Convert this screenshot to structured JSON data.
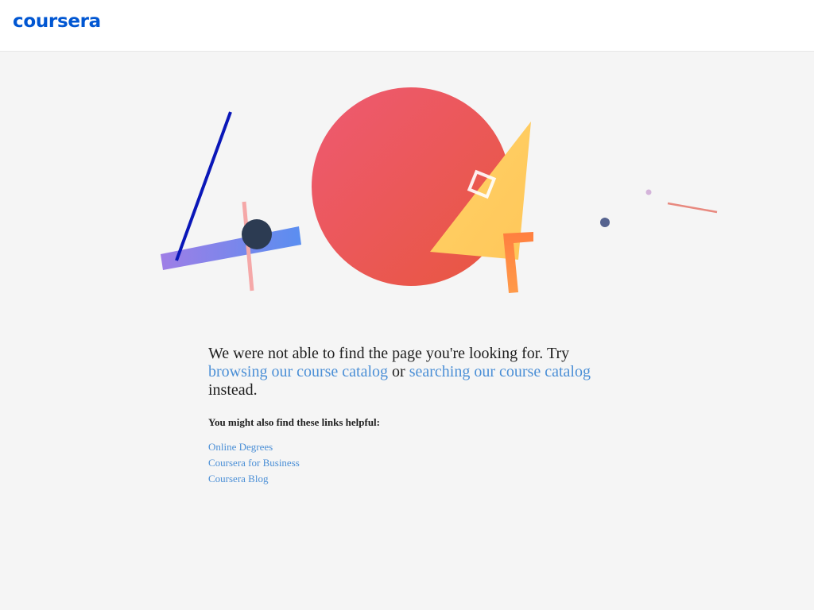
{
  "header": {
    "logo_text": "coursera"
  },
  "illustration": {
    "icon": "404-geometric-illustration",
    "colors": {
      "circle_start": "#ee5a72",
      "circle_end": "#e8563f",
      "triangle": "#ffd166",
      "bar_start": "#9f7ee6",
      "bar_end": "#5a8ef0",
      "line": "#0a17b8",
      "dark_dot": "#2c3b52",
      "small_dot": "#56638f",
      "pink": "#f5a8a8",
      "orange": "#ff7f3f"
    }
  },
  "main": {
    "message_prefix": "We were not able to find the page you're looking for. Try",
    "link_browse": "browsing our course catalog",
    "connector": "or",
    "link_search": "searching our course catalog",
    "message_suffix": "instead.",
    "helpful_heading": "You might also find these links helpful:",
    "helpful_links": [
      "Online Degrees",
      "Coursera for Business",
      "Coursera Blog"
    ]
  }
}
